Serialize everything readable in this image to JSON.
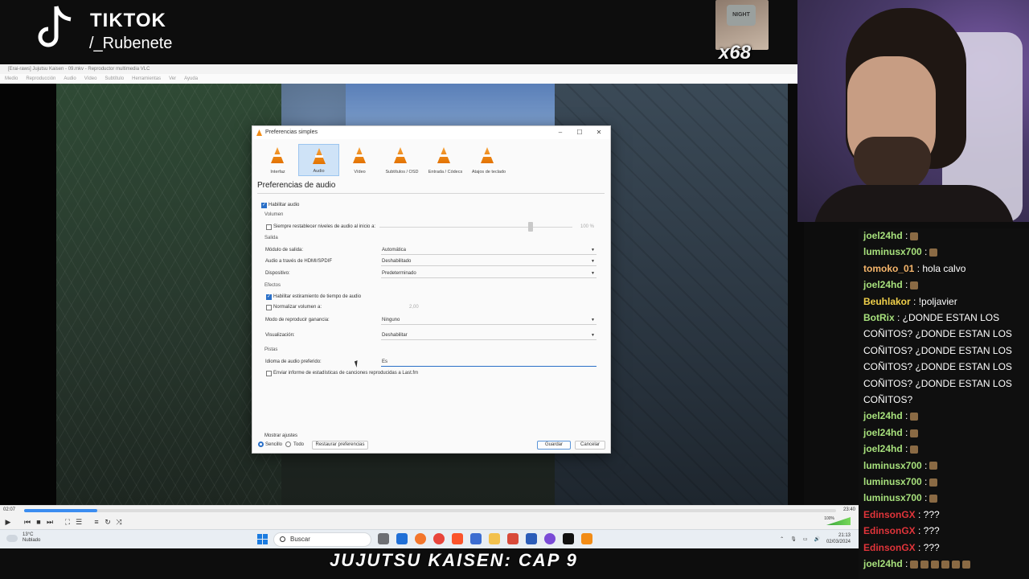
{
  "overlay": {
    "tiktok_title": "TIKTOK",
    "tiktok_handle": "/_Rubenete",
    "emote_shirt_text": "NIGHT",
    "emote_multiplier": "x68",
    "caption": "JUJUTSU KAISEN: CAP 9"
  },
  "vlc": {
    "window_title": "[Erai-raws] Jujutsu Kaisen - 09.mkv - Reproductor multimedia VLC",
    "menu": [
      "Medio",
      "Reproducción",
      "Audio",
      "Vídeo",
      "Subtítulo",
      "Herramientas",
      "Ver",
      "Ayuda"
    ],
    "time_elapsed": "02:07",
    "time_total": "23:40",
    "progress": 0.09,
    "volume_label": "100%"
  },
  "dialog": {
    "title": "Preferencias simples",
    "categories": [
      "Interfaz",
      "Audio",
      "Vídeo",
      "Subtítulos / OSD",
      "Entrada / Códecs",
      "Atajos de teclado"
    ],
    "selected_category": "Audio",
    "heading": "Preferencias de audio",
    "enable_audio": "Habilitar audio",
    "section_volume": "Volumen",
    "reset_volume_label": "Siempre restablecer niveles de audio al inicio a:",
    "reset_volume_value": "100 %",
    "section_output": "Salida",
    "output_module_label": "Módulo de salida:",
    "output_module_value": "Automática",
    "hdmi_label": "Audio a través de HDMI/SPDIF",
    "hdmi_value": "Deshabilitado",
    "device_label": "Dispositivo:",
    "device_value": "Predeterminado",
    "section_effects": "Efectos",
    "time_stretch_label": "Habilitar estiramiento de tiempo de audio",
    "normalize_label": "Normalizar volumen a:",
    "normalize_value": "2,00",
    "replay_gain_label": "Modo de reproducir ganancia:",
    "replay_gain_value": "Ninguno",
    "visualization_label": "Visualización:",
    "visualization_value": "Deshabilitar",
    "section_tracks": "Pistas",
    "preferred_lang_label": "Idioma de audio preferido:",
    "preferred_lang_value": "Es",
    "lastfm_label": "Enviar informe de estadísticas de canciones reproducidas a Last.fm",
    "show_settings_label": "Mostrar ajustes",
    "simple_label": "Sencillo",
    "all_label": "Todo",
    "reset_button": "Restaurar preferencias",
    "save_button": "Guardar",
    "cancel_button": "Cancelar"
  },
  "taskbar": {
    "temp": "13°C",
    "weather": "Nublado",
    "search_placeholder": "Buscar",
    "time": "21:13",
    "date": "02/03/2024"
  },
  "chat": {
    "messages": [
      {
        "user": "joel24hd",
        "text": ":",
        "color": "#a7e07c",
        "emotes": 1
      },
      {
        "user": "luminusx700",
        "text": ":",
        "color": "#a7e07c",
        "emotes": 1
      },
      {
        "user": "tomoko_01",
        "text": ": hola calvo",
        "color": "#f5b56b",
        "emotes": 0
      },
      {
        "user": "joel24hd",
        "text": ":",
        "color": "#a7e07c",
        "emotes": 1
      },
      {
        "user": "Beuhlakor",
        "text": ": !poljavier",
        "color": "#f0d04a",
        "emotes": 0
      },
      {
        "user": "BotRix",
        "text": ": ¿DONDE ESTAN LOS",
        "color": "#a7e07c",
        "emotes": 0
      },
      {
        "user": "",
        "text": "COÑITOS? ¿DONDE ESTAN LOS",
        "color": "#fff",
        "emotes": 0
      },
      {
        "user": "",
        "text": "COÑITOS? ¿DONDE ESTAN LOS",
        "color": "#fff",
        "emotes": 0
      },
      {
        "user": "",
        "text": "COÑITOS? ¿DONDE ESTAN LOS",
        "color": "#fff",
        "emotes": 0
      },
      {
        "user": "",
        "text": "COÑITOS? ¿DONDE ESTAN LOS",
        "color": "#fff",
        "emotes": 0
      },
      {
        "user": "",
        "text": "COÑITOS?",
        "color": "#fff",
        "emotes": 0
      },
      {
        "user": "joel24hd",
        "text": ":",
        "color": "#a7e07c",
        "emotes": 1
      },
      {
        "user": "joel24hd",
        "text": ":",
        "color": "#a7e07c",
        "emotes": 1
      },
      {
        "user": "joel24hd",
        "text": ":",
        "color": "#a7e07c",
        "emotes": 1
      },
      {
        "user": "luminusx700",
        "text": ":",
        "color": "#a7e07c",
        "emotes": 1
      },
      {
        "user": "luminusx700",
        "text": ":",
        "color": "#a7e07c",
        "emotes": 1
      },
      {
        "user": "luminusx700",
        "text": ":",
        "color": "#a7e07c",
        "emotes": 1
      },
      {
        "user": "EdinsonGX",
        "text": ": ???",
        "color": "#e0343a",
        "emotes": 0
      },
      {
        "user": "EdinsonGX",
        "text": ": ???",
        "color": "#e0343a",
        "emotes": 0
      },
      {
        "user": "EdinsonGX",
        "text": ": ???",
        "color": "#e0343a",
        "emotes": 0
      },
      {
        "user": "joel24hd",
        "text": ":",
        "color": "#a7e07c",
        "emotes": 6
      }
    ]
  }
}
